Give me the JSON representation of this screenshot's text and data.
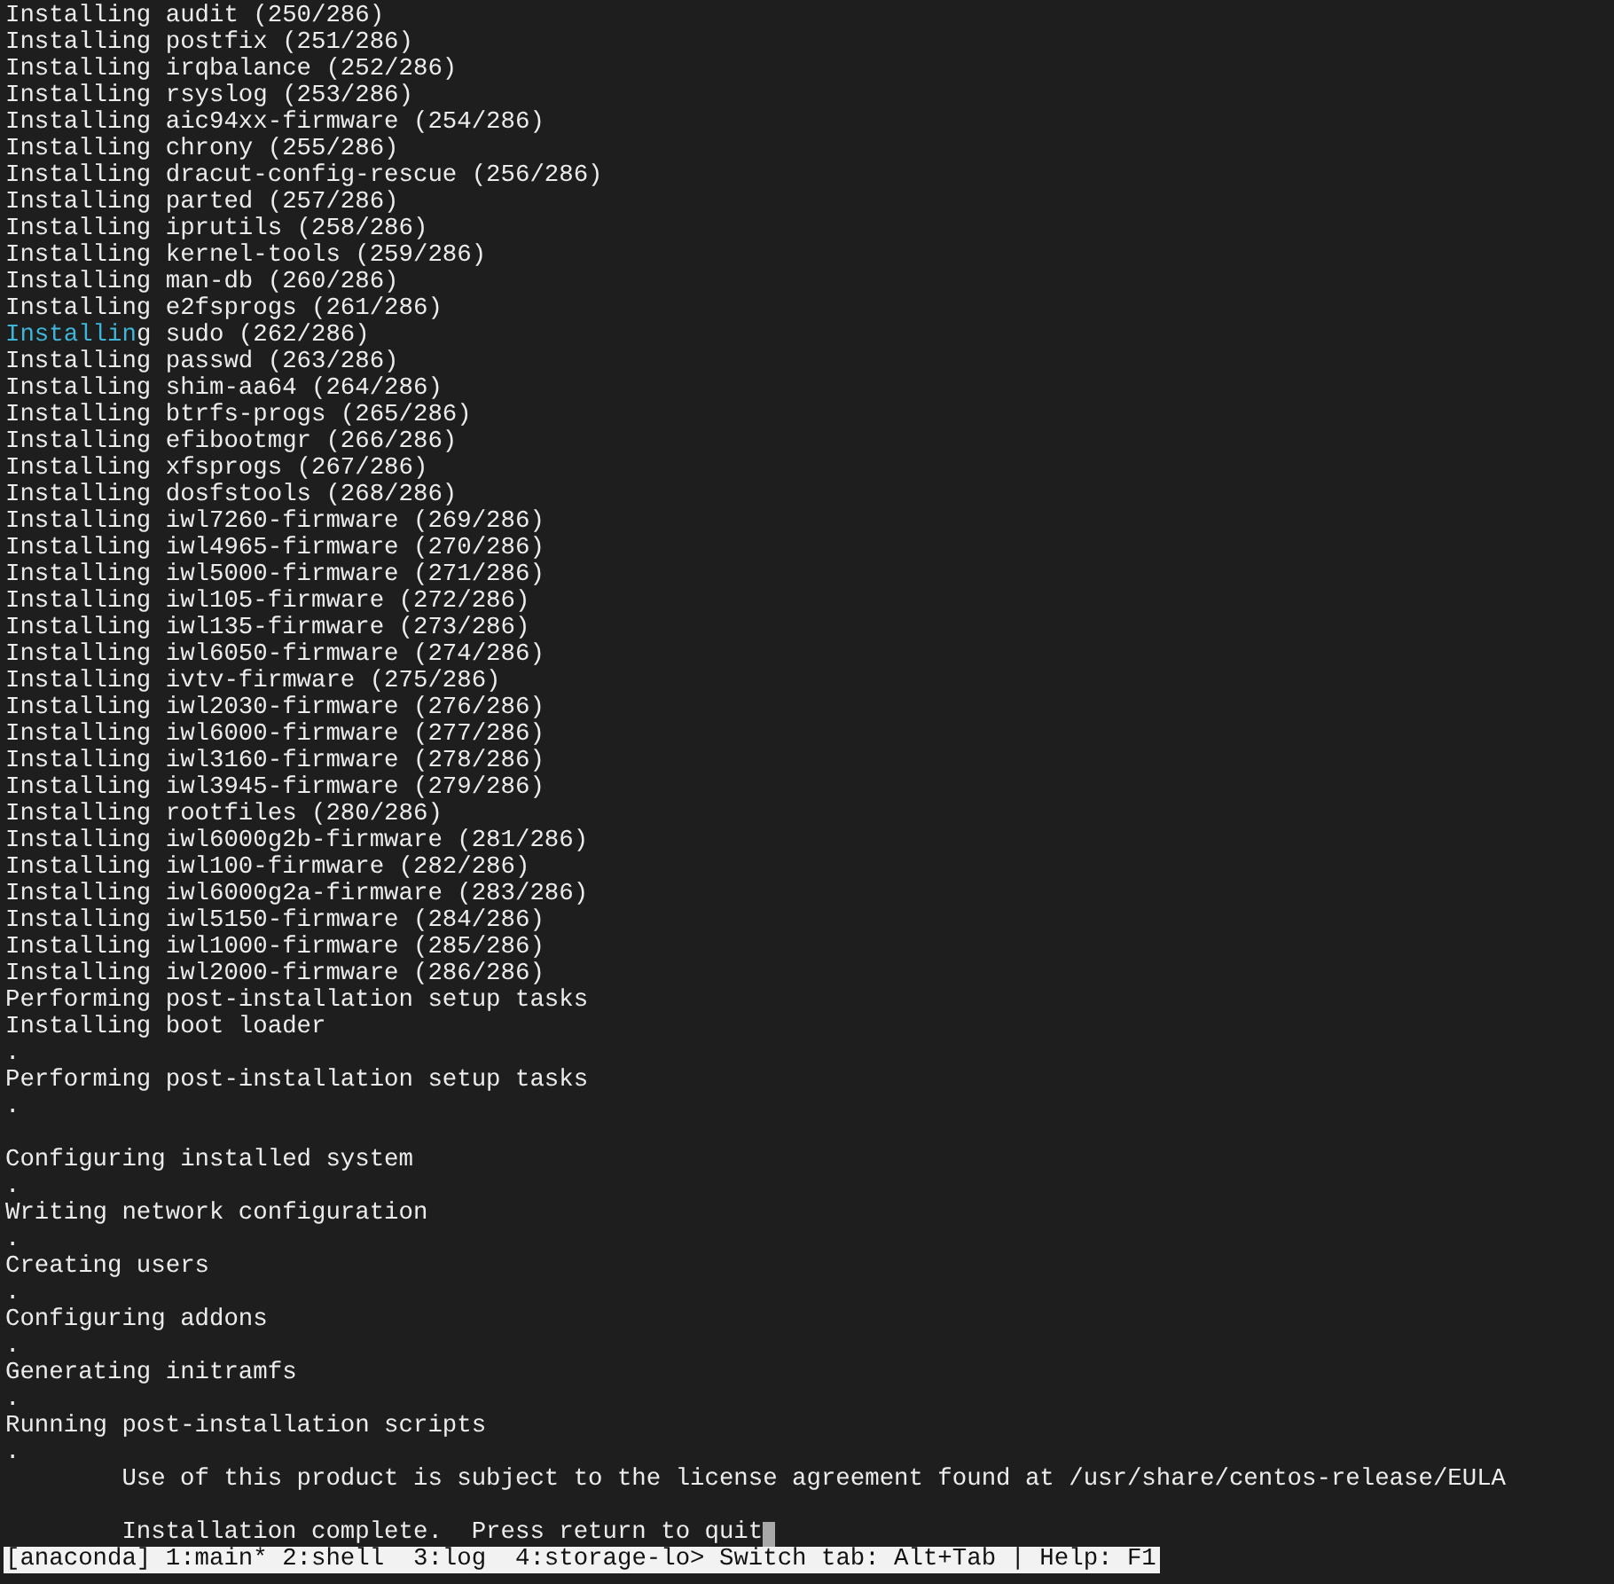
{
  "terminal": {
    "lines": [
      {
        "kind": "text",
        "text": "Installing audit (250/286)",
        "highlighted": false
      },
      {
        "kind": "text",
        "text": "Installing postfix (251/286)",
        "highlighted": false
      },
      {
        "kind": "text",
        "text": "Installing irqbalance (252/286)",
        "highlighted": false
      },
      {
        "kind": "text",
        "text": "Installing rsyslog (253/286)",
        "highlighted": false
      },
      {
        "kind": "text",
        "text": "Installing aic94xx-firmware (254/286)",
        "highlighted": false
      },
      {
        "kind": "text",
        "text": "Installing chrony (255/286)",
        "highlighted": false
      },
      {
        "kind": "text",
        "text": "Installing dracut-config-rescue (256/286)",
        "highlighted": false
      },
      {
        "kind": "text",
        "text": "Installing parted (257/286)",
        "highlighted": false
      },
      {
        "kind": "text",
        "text": "Installing iprutils (258/286)",
        "highlighted": false
      },
      {
        "kind": "text",
        "text": "Installing kernel-tools (259/286)",
        "highlighted": false
      },
      {
        "kind": "text",
        "text": "Installing man-db (260/286)",
        "highlighted": false
      },
      {
        "kind": "text",
        "text": "Installing e2fsprogs (261/286)",
        "highlighted": false
      },
      {
        "kind": "text",
        "text": "Installing sudo (262/286)",
        "highlighted": true
      },
      {
        "kind": "text",
        "text": "Installing passwd (263/286)",
        "highlighted": false
      },
      {
        "kind": "text",
        "text": "Installing shim-aa64 (264/286)",
        "highlighted": false
      },
      {
        "kind": "text",
        "text": "Installing btrfs-progs (265/286)",
        "highlighted": false
      },
      {
        "kind": "text",
        "text": "Installing efibootmgr (266/286)",
        "highlighted": false
      },
      {
        "kind": "text",
        "text": "Installing xfsprogs (267/286)",
        "highlighted": false
      },
      {
        "kind": "text",
        "text": "Installing dosfstools (268/286)",
        "highlighted": false
      },
      {
        "kind": "text",
        "text": "Installing iwl7260-firmware (269/286)",
        "highlighted": false
      },
      {
        "kind": "text",
        "text": "Installing iwl4965-firmware (270/286)",
        "highlighted": false
      },
      {
        "kind": "text",
        "text": "Installing iwl5000-firmware (271/286)",
        "highlighted": false
      },
      {
        "kind": "text",
        "text": "Installing iwl105-firmware (272/286)",
        "highlighted": false
      },
      {
        "kind": "text",
        "text": "Installing iwl135-firmware (273/286)",
        "highlighted": false
      },
      {
        "kind": "text",
        "text": "Installing iwl6050-firmware (274/286)",
        "highlighted": false
      },
      {
        "kind": "text",
        "text": "Installing ivtv-firmware (275/286)",
        "highlighted": false
      },
      {
        "kind": "text",
        "text": "Installing iwl2030-firmware (276/286)",
        "highlighted": false
      },
      {
        "kind": "text",
        "text": "Installing iwl6000-firmware (277/286)",
        "highlighted": false
      },
      {
        "kind": "text",
        "text": "Installing iwl3160-firmware (278/286)",
        "highlighted": false
      },
      {
        "kind": "text",
        "text": "Installing iwl3945-firmware (279/286)",
        "highlighted": false
      },
      {
        "kind": "text",
        "text": "Installing rootfiles (280/286)",
        "highlighted": false
      },
      {
        "kind": "text",
        "text": "Installing iwl6000g2b-firmware (281/286)",
        "highlighted": false
      },
      {
        "kind": "text",
        "text": "Installing iwl100-firmware (282/286)",
        "highlighted": false
      },
      {
        "kind": "text",
        "text": "Installing iwl6000g2a-firmware (283/286)",
        "highlighted": false
      },
      {
        "kind": "text",
        "text": "Installing iwl5150-firmware (284/286)",
        "highlighted": false
      },
      {
        "kind": "text",
        "text": "Installing iwl1000-firmware (285/286)",
        "highlighted": false
      },
      {
        "kind": "text",
        "text": "Installing iwl2000-firmware (286/286)",
        "highlighted": false
      },
      {
        "kind": "text",
        "text": "Performing post-installation setup tasks",
        "highlighted": false
      },
      {
        "kind": "text",
        "text": "Installing boot loader",
        "highlighted": false
      },
      {
        "kind": "text",
        "text": ".",
        "highlighted": false
      },
      {
        "kind": "text",
        "text": "Performing post-installation setup tasks",
        "highlighted": false
      },
      {
        "kind": "text",
        "text": ".",
        "highlighted": false
      },
      {
        "kind": "blank"
      },
      {
        "kind": "text",
        "text": "Configuring installed system",
        "highlighted": false
      },
      {
        "kind": "text",
        "text": ".",
        "highlighted": false
      },
      {
        "kind": "text",
        "text": "Writing network configuration",
        "highlighted": false
      },
      {
        "kind": "text",
        "text": ".",
        "highlighted": false
      },
      {
        "kind": "text",
        "text": "Creating users",
        "highlighted": false
      },
      {
        "kind": "text",
        "text": ".",
        "highlighted": false
      },
      {
        "kind": "text",
        "text": "Configuring addons",
        "highlighted": false
      },
      {
        "kind": "text",
        "text": ".",
        "highlighted": false
      },
      {
        "kind": "text",
        "text": "Generating initramfs",
        "highlighted": false
      },
      {
        "kind": "text",
        "text": ".",
        "highlighted": false
      },
      {
        "kind": "text",
        "text": "Running post-installation scripts",
        "highlighted": false
      },
      {
        "kind": "text",
        "text": ".",
        "highlighted": false
      },
      {
        "kind": "indented",
        "text": "Use of this product is subject to the license agreement found at /usr/share/centos-release/EULA"
      },
      {
        "kind": "blank"
      },
      {
        "kind": "indented",
        "text": "Installation complete.  Press return to quit",
        "cursor": true
      }
    ]
  },
  "status_bar": {
    "text": "[anaconda] 1:main* 2:shell  3:log  4:storage-lo> Switch tab: Alt+Tab | Help: F1"
  }
}
